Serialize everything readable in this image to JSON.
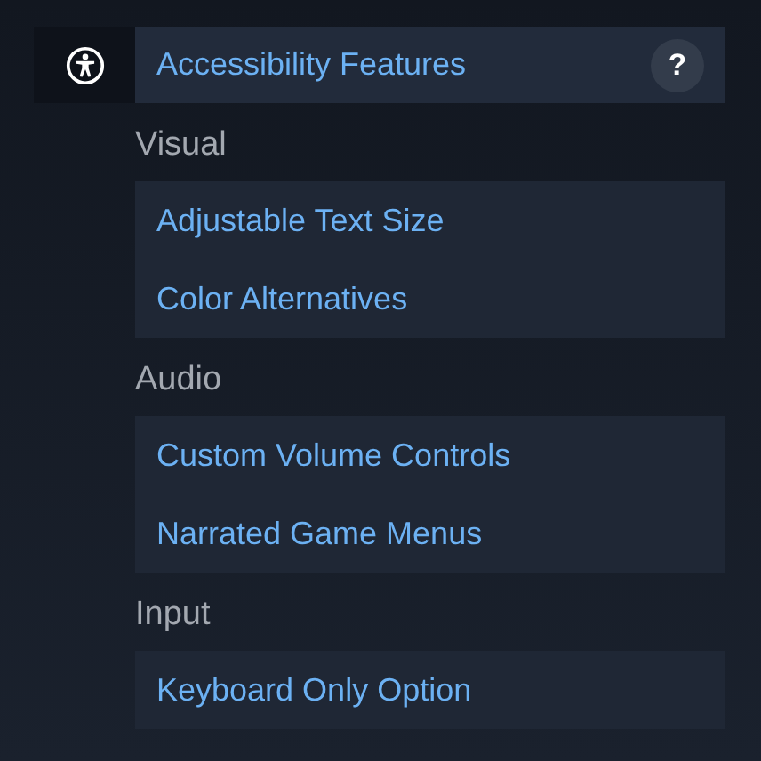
{
  "header": {
    "title": "Accessibility Features",
    "help": "?"
  },
  "sections": [
    {
      "heading": "Visual",
      "items": [
        "Adjustable Text Size",
        "Color Alternatives"
      ]
    },
    {
      "heading": "Audio",
      "items": [
        "Custom Volume Controls",
        "Narrated Game Menus"
      ]
    },
    {
      "heading": "Input",
      "items": [
        "Keyboard Only Option"
      ]
    }
  ]
}
